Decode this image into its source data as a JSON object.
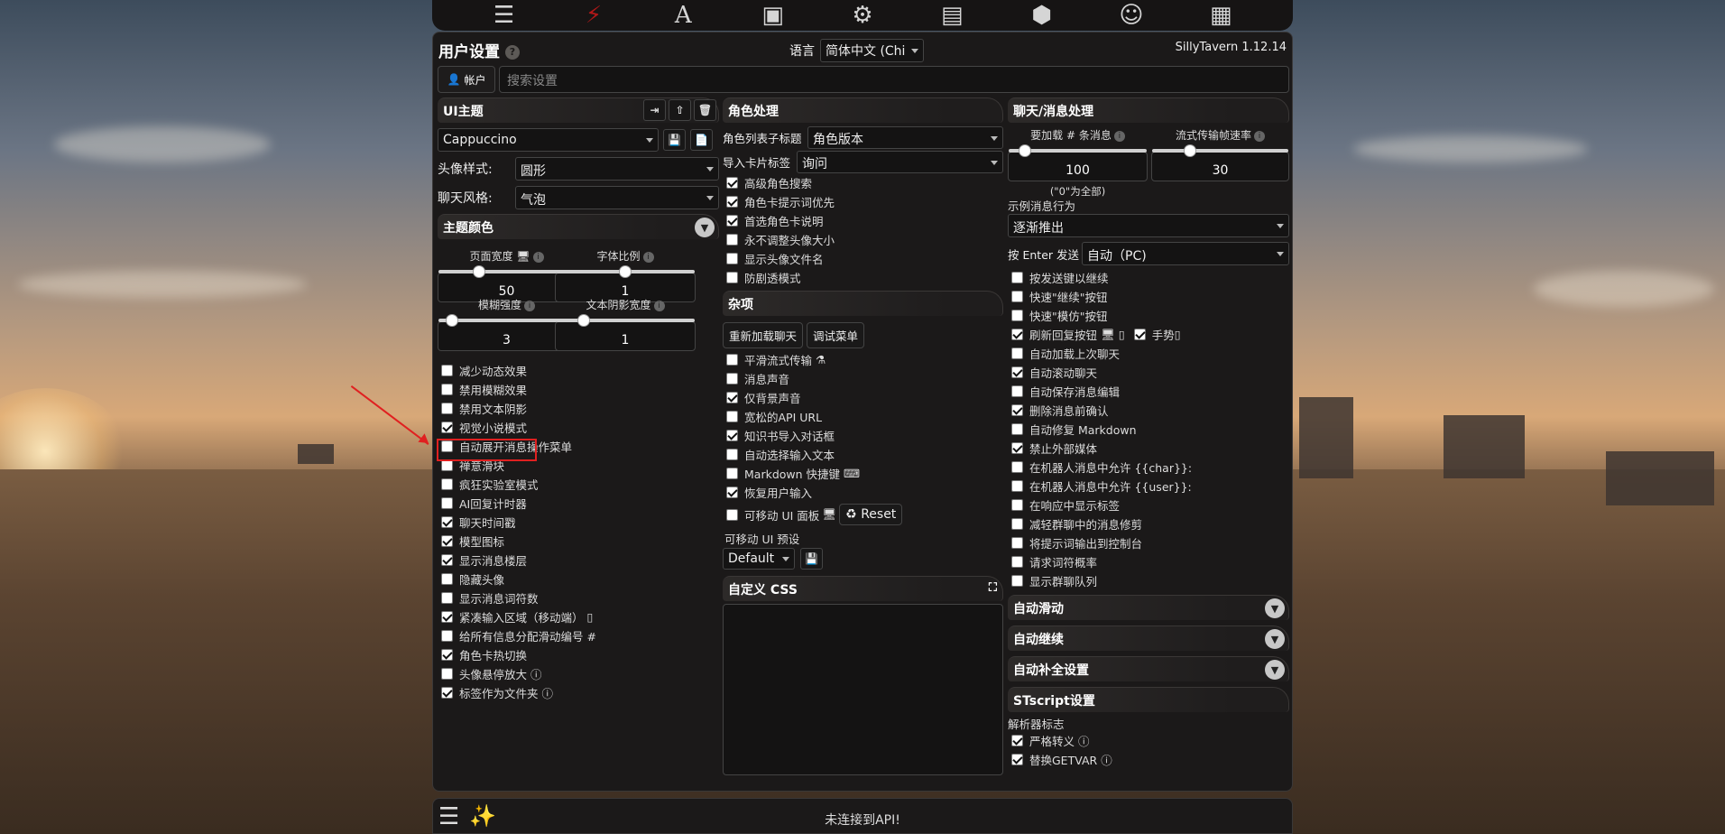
{
  "topnav": {
    "items": [
      {
        "name": "sliders-icon",
        "glyph": "☰"
      },
      {
        "name": "plug-icon",
        "glyph": "🔌"
      },
      {
        "name": "font-icon",
        "glyph": "A"
      },
      {
        "name": "book-icon",
        "glyph": "📖"
      },
      {
        "name": "user-gear-icon",
        "glyph": "👤"
      },
      {
        "name": "image-icon",
        "glyph": "🖼"
      },
      {
        "name": "cubes-icon",
        "glyph": "⬢"
      },
      {
        "name": "smiley-icon",
        "glyph": "☺"
      },
      {
        "name": "id-card-icon",
        "glyph": "🪪"
      }
    ]
  },
  "header": {
    "title": "用户设置",
    "help": "?",
    "lang_label": "语言",
    "lang_value": "简体中文 (Chi",
    "version": "SillyTavern 1.12.14",
    "account_label": "帐户",
    "search_placeholder": "搜索设置"
  },
  "ui_theme": {
    "title": "UI主题",
    "theme_value": "Cappuccino",
    "avatar_style_label": "头像样式:",
    "avatar_style_value": "圆形",
    "chat_style_label": "聊天风格:",
    "chat_style_value": "气泡",
    "theme_colors": "主题颜色",
    "sliders": [
      {
        "label": "页面宽度",
        "value": "50",
        "level": 0.3
      },
      {
        "label": "字体比例",
        "value": "1",
        "level": 0.5
      },
      {
        "label": "模糊强度",
        "value": "3",
        "level": 0.1
      },
      {
        "label": "文本阴影宽度",
        "value": "1",
        "level": 0.2
      }
    ],
    "checkboxes": [
      {
        "label": "减少动态效果",
        "checked": false
      },
      {
        "label": "禁用模糊效果",
        "checked": false
      },
      {
        "label": "禁用文本阴影",
        "checked": false
      },
      {
        "label": "视觉小说模式",
        "checked": true
      },
      {
        "label": "自动展开消息操作菜单",
        "checked": false
      },
      {
        "label": "禅意滑块",
        "checked": false
      },
      {
        "label": "疯狂实验室模式",
        "checked": false
      },
      {
        "label": "AI回复计时器",
        "checked": false
      },
      {
        "label": "聊天时间戳",
        "checked": true
      },
      {
        "label": "模型图标",
        "checked": true
      },
      {
        "label": "显示消息楼层",
        "checked": true
      },
      {
        "label": "隐藏头像",
        "checked": false
      },
      {
        "label": "显示消息词符数",
        "checked": false
      },
      {
        "label": "紧凑输入区域（移动端）",
        "checked": true
      },
      {
        "label": "给所有信息分配滑动编号 #",
        "checked": false
      },
      {
        "label": "角色卡热切换",
        "checked": true
      },
      {
        "label": "头像悬停放大",
        "checked": false
      },
      {
        "label": "标签作为文件夹",
        "checked": true
      }
    ]
  },
  "char_handling": {
    "title": "角色处理",
    "list_label": "角色列表子标题",
    "list_value": "角色版本",
    "import_label": "导入卡片标签",
    "import_value": "询问",
    "checkboxes": [
      {
        "label": "高级角色搜索",
        "checked": true
      },
      {
        "label": "角色卡提示词优先",
        "checked": true
      },
      {
        "label": "首选角色卡说明",
        "checked": true
      },
      {
        "label": "永不调整头像大小",
        "checked": false
      },
      {
        "label": "显示头像文件名",
        "checked": false
      },
      {
        "label": "防剧透模式",
        "checked": false
      }
    ]
  },
  "misc": {
    "title": "杂项",
    "reload_btn": "重新加载聊天",
    "debug_btn": "调试菜单",
    "checkboxes": [
      {
        "label": "平滑流式传输",
        "checked": false
      },
      {
        "label": "消息声音",
        "checked": false
      },
      {
        "label": "仅背景声音",
        "checked": true
      },
      {
        "label": "宽松的API URL",
        "checked": false
      },
      {
        "label": "知识书导入对话框",
        "checked": true
      },
      {
        "label": "自动选择输入文本",
        "checked": false
      },
      {
        "label": "Markdown 快捷键",
        "checked": false
      },
      {
        "label": "恢复用户输入",
        "checked": true
      }
    ],
    "movable_label": "可移动 UI 面板",
    "reset_btn": "Reset",
    "preset_label": "可移动 UI 预设",
    "preset_value": "Default",
    "custom_css": "自定义 CSS"
  },
  "chat_handling": {
    "title": "聊天/消息处理",
    "load_label": "要加载 # 条消息",
    "load_value": "100",
    "load_level": 0.12,
    "load_hint": "(\"0\"为全部)",
    "stream_label": "流式传输帧速率",
    "stream_value": "30",
    "stream_level": 0.28,
    "example_label": "示例消息行为",
    "example_value": "逐渐推出",
    "enter_label": "按 Enter 发送",
    "enter_value": "自动（PC)",
    "checkboxes": [
      {
        "label": "按发送键以继续",
        "checked": false
      },
      {
        "label": "快速\"继续\"按钮",
        "checked": false
      },
      {
        "label": "快速\"模仿\"按钮",
        "checked": false
      },
      {
        "label": "刷新回复按钮",
        "checked": true
      },
      {
        "label": "自动加载上次聊天",
        "checked": false
      },
      {
        "label": "自动滚动聊天",
        "checked": true
      },
      {
        "label": "自动保存消息编辑",
        "checked": false
      },
      {
        "label": "删除消息前确认",
        "checked": true
      },
      {
        "label": "自动修复 Markdown",
        "checked": false
      },
      {
        "label": "禁止外部媒体",
        "checked": true
      },
      {
        "label": "在机器人消息中允许 {{char}}:",
        "checked": false
      },
      {
        "label": "在机器人消息中允许 {{user}}:",
        "checked": false
      },
      {
        "label": "在响应中显示标签",
        "checked": false
      },
      {
        "label": "减轻群聊中的消息修剪",
        "checked": false
      },
      {
        "label": "将提示词输出到控制台",
        "checked": false
      },
      {
        "label": "请求词符概率",
        "checked": false
      },
      {
        "label": "显示群聊队列",
        "checked": false
      }
    ],
    "gesture_label": "手势",
    "auto_scroll": "自动滑动",
    "auto_continue": "自动继续",
    "autocomplete": "自动补全设置",
    "stscript": "STscript设置",
    "parser_label": "解析器标志",
    "parser_checkboxes": [
      {
        "label": "严格转义",
        "checked": true
      },
      {
        "label": "替换GETVAR",
        "checked": true
      }
    ]
  },
  "bottom": {
    "status": "未连接到API!"
  }
}
